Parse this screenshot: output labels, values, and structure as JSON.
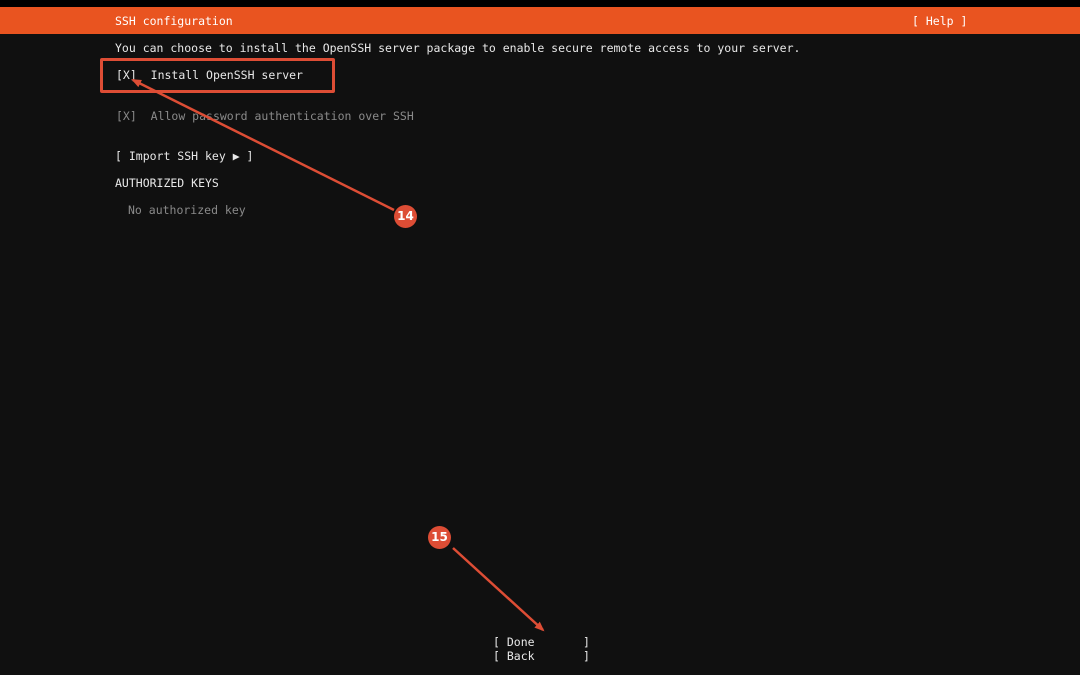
{
  "header": {
    "title": "SSH configuration",
    "help_label": "[ Help ]",
    "bar_color": "#e95420"
  },
  "main": {
    "intro": "You can choose to install the OpenSSH server package to enable secure remote access to your server.",
    "install_openssh": {
      "checkbox": "[X]",
      "label": "Install OpenSSH server"
    },
    "allow_password": {
      "checkbox": "[X]",
      "label": "Allow password authentication over SSH"
    },
    "import_ssh_key": "[ Import SSH key ▶ ]",
    "authorized_keys_heading": "AUTHORIZED KEYS",
    "no_key_text": "No authorized key"
  },
  "footer": {
    "done_label": "[ Done       ]",
    "back_label": "[ Back       ]"
  },
  "annotations": {
    "color": "#dd4d35",
    "step_a": "14",
    "step_b": "15"
  }
}
